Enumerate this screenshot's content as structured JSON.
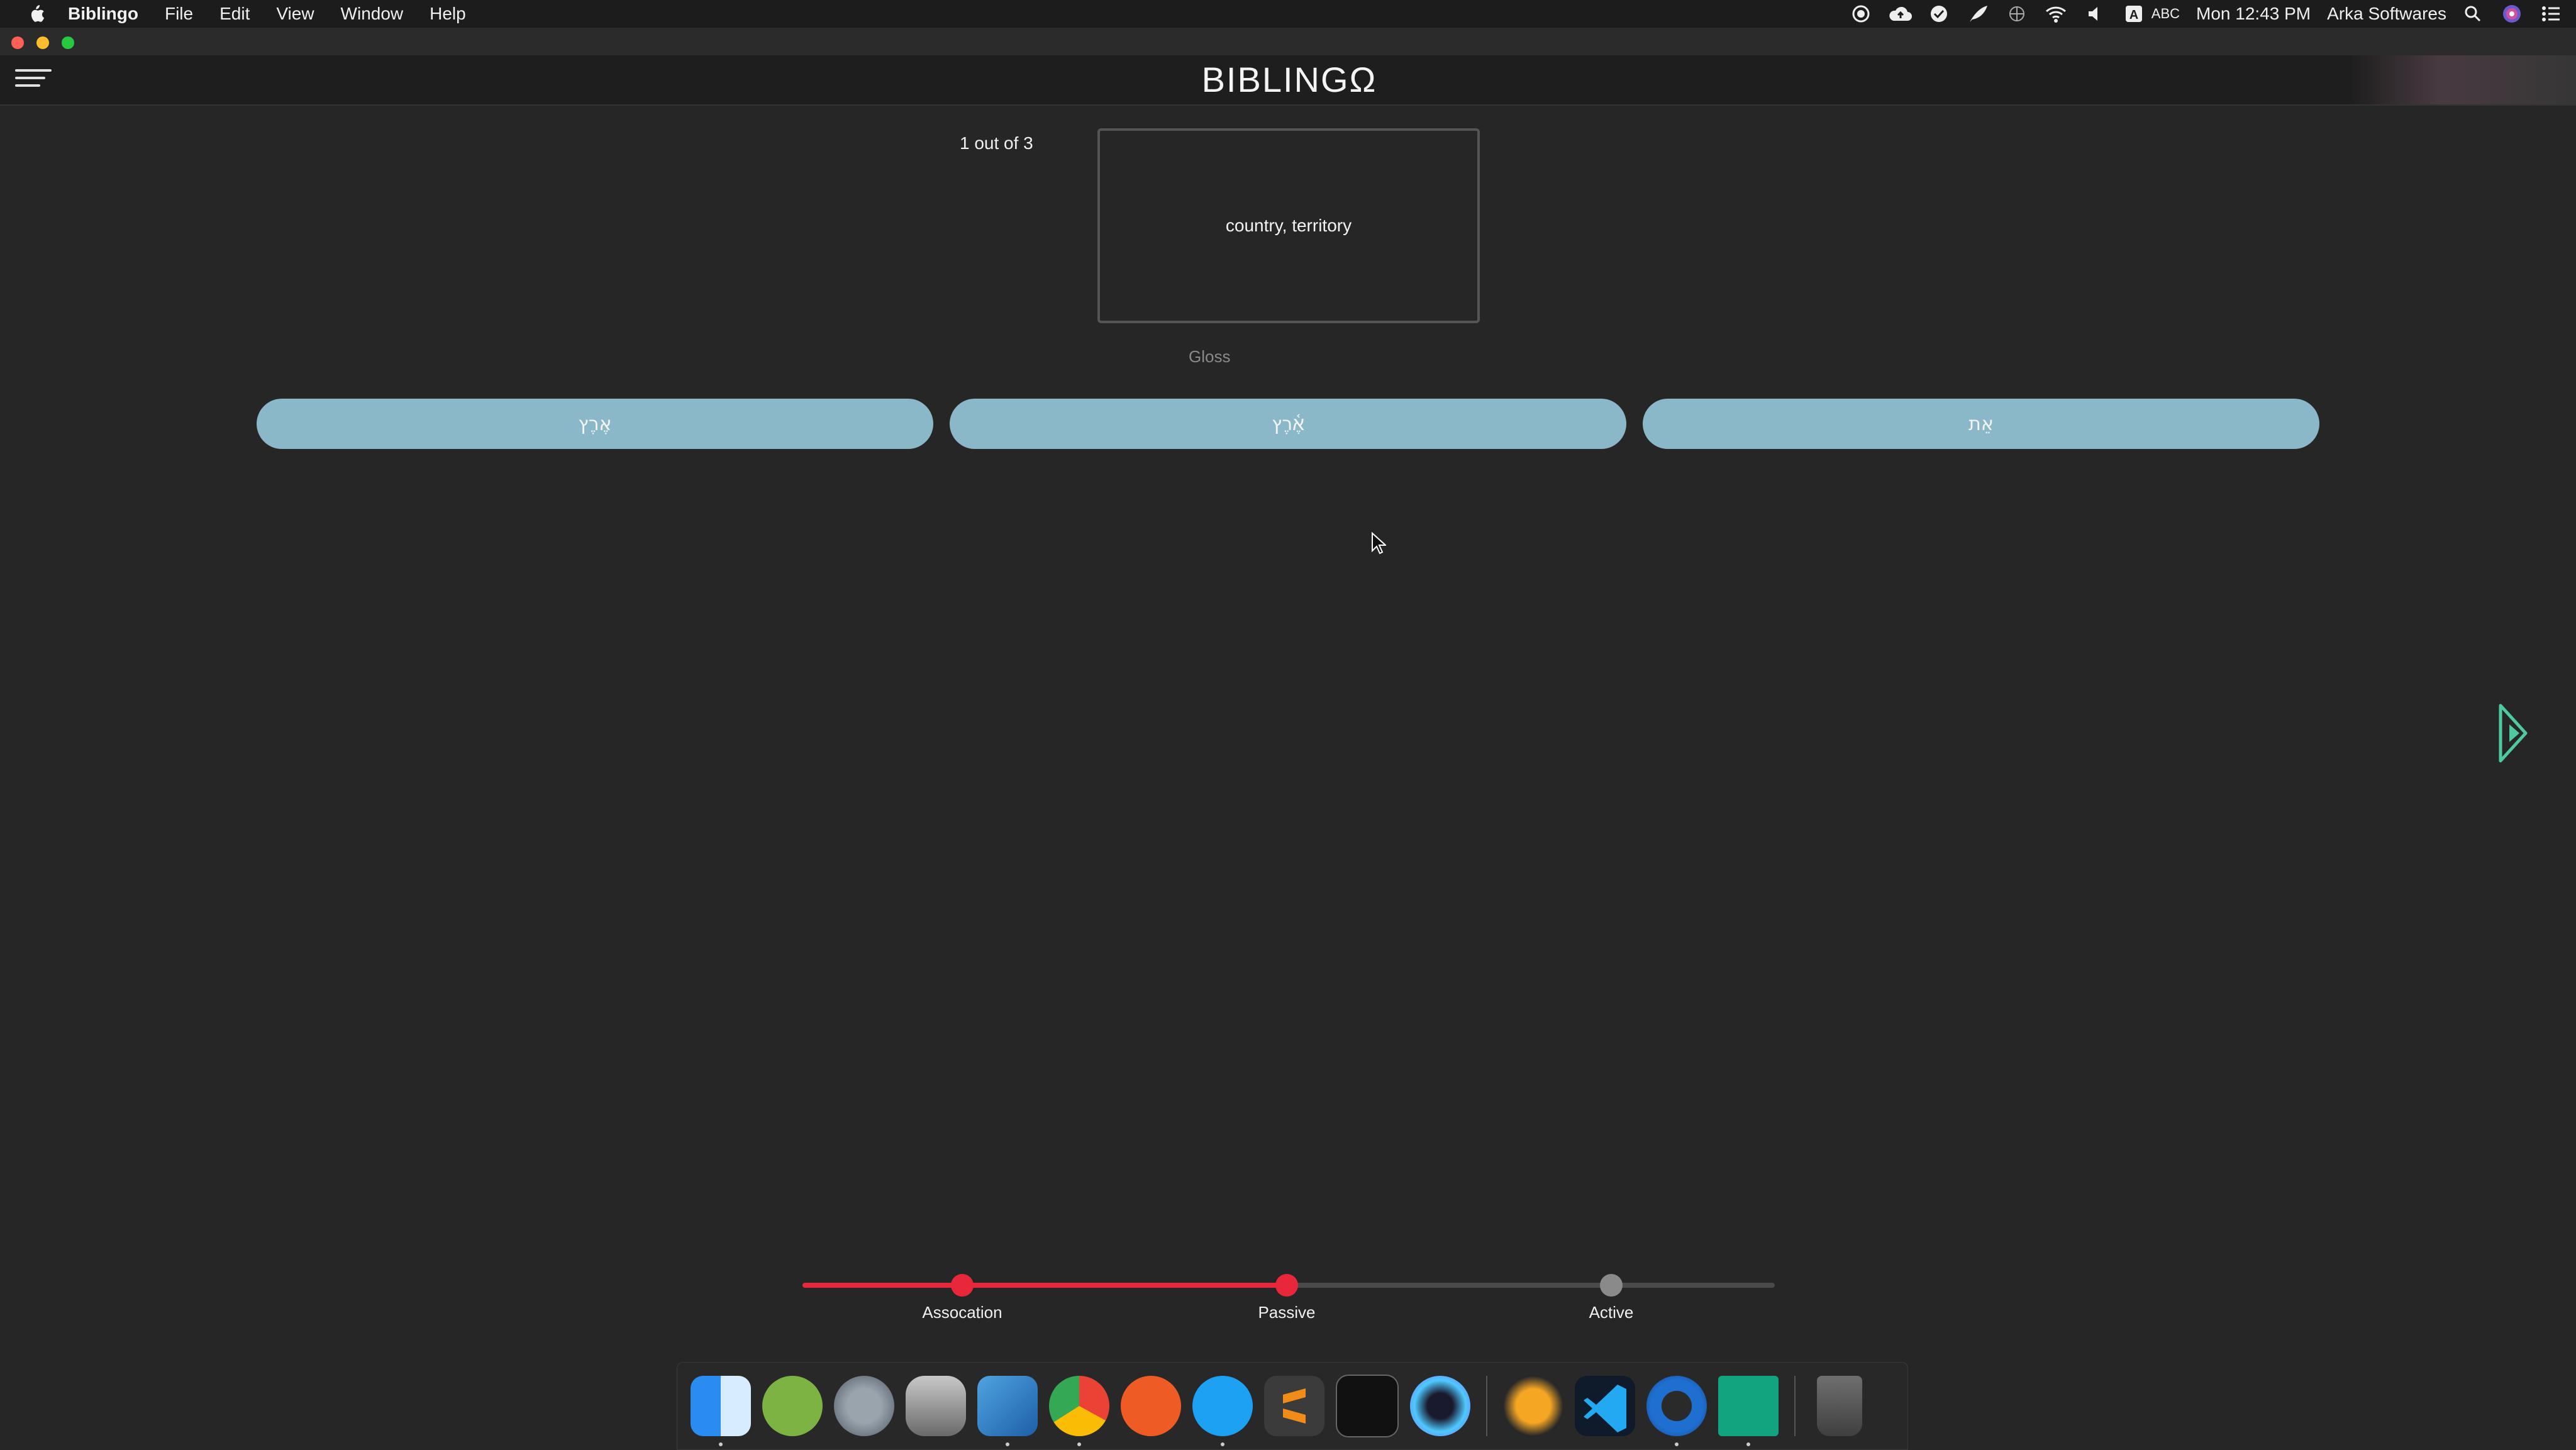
{
  "menubar": {
    "app_name": "Biblingo",
    "menus": [
      "File",
      "Edit",
      "View",
      "Window",
      "Help"
    ],
    "abc": "ABC",
    "clock": "Mon 12:43 PM",
    "user": "Arka Softwares"
  },
  "header": {
    "logo": "BIBLINGΩ"
  },
  "quiz": {
    "counter": "1 out of 3",
    "prompt": "country, territory",
    "caption": "Gloss",
    "choices": [
      "אֶרֶץ",
      "אֶ֫רֶץ",
      "אֵת"
    ]
  },
  "progress": {
    "stages": [
      "Assocation",
      "Passive",
      "Active"
    ],
    "completed_stages": 2,
    "accent_color": "#e8273a",
    "inactive_color": "#4a4a4a"
  },
  "dock": {
    "apps": [
      "Finder",
      "Android Studio",
      "Launchpad",
      "Sequel Pro",
      "Xcode",
      "Google Chrome",
      "Postman",
      "Skype",
      "Sublime Text",
      "Terminal",
      "Siri",
      "Transmit",
      "Visual Studio Code",
      "QuickTime Player",
      "Biblingo",
      "Trash"
    ]
  }
}
